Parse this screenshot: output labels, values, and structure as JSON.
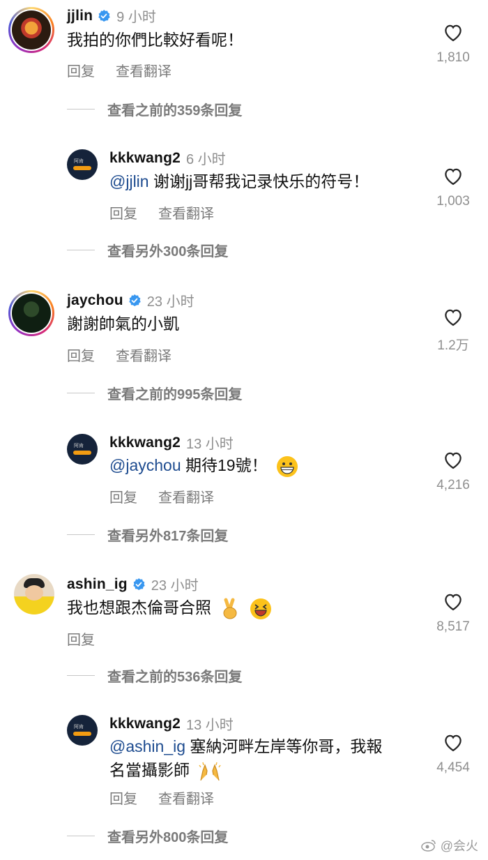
{
  "comments": [
    {
      "username": "jjlin",
      "time": "9 小时",
      "text": "我拍的你們比較好看呢！",
      "actions": [
        "回复",
        "查看翻译"
      ],
      "likes": "1,810",
      "more": "查看之前的359条回复"
    },
    {
      "username": "kkkwang2",
      "time": "6 小时",
      "mention": "@jjlin",
      "text": " 谢谢jj哥帮我记录快乐的符号！",
      "actions": [
        "回复",
        "查看翻译"
      ],
      "likes": "1,003",
      "more": "查看另外300条回复"
    },
    {
      "username": "jaychou",
      "time": "23 小时",
      "text": "謝謝帥氣的小凱",
      "actions": [
        "回复",
        "查看翻译"
      ],
      "likes": "1.2万",
      "more": "查看之前的995条回复"
    },
    {
      "username": "kkkwang2",
      "time": "13 小时",
      "mention": "@jaychou",
      "text": " 期待19號！",
      "actions": [
        "回复",
        "查看翻译"
      ],
      "likes": "4,216",
      "more": "查看另外817条回复"
    },
    {
      "username": "ashin_ig",
      "time": "23 小时",
      "text": "我也想跟杰倫哥合照",
      "actions": [
        "回复"
      ],
      "likes": "8,517",
      "more": "查看之前的536条回复"
    },
    {
      "username": "kkkwang2",
      "time": "13 小时",
      "mention": "@ashin_ig",
      "text": " 塞納河畔左岸等你哥，我報",
      "text2": "名當攝影師",
      "actions": [
        "回复",
        "查看翻译"
      ],
      "likes": "4,454",
      "more": "查看另外800条回复"
    }
  ],
  "avatar_badge_text": "阿肯",
  "watermark": "@会火",
  "colors": {
    "mention": "#1d4b8f",
    "verified": "#3897f0",
    "secondary": "#8e8e8e"
  }
}
